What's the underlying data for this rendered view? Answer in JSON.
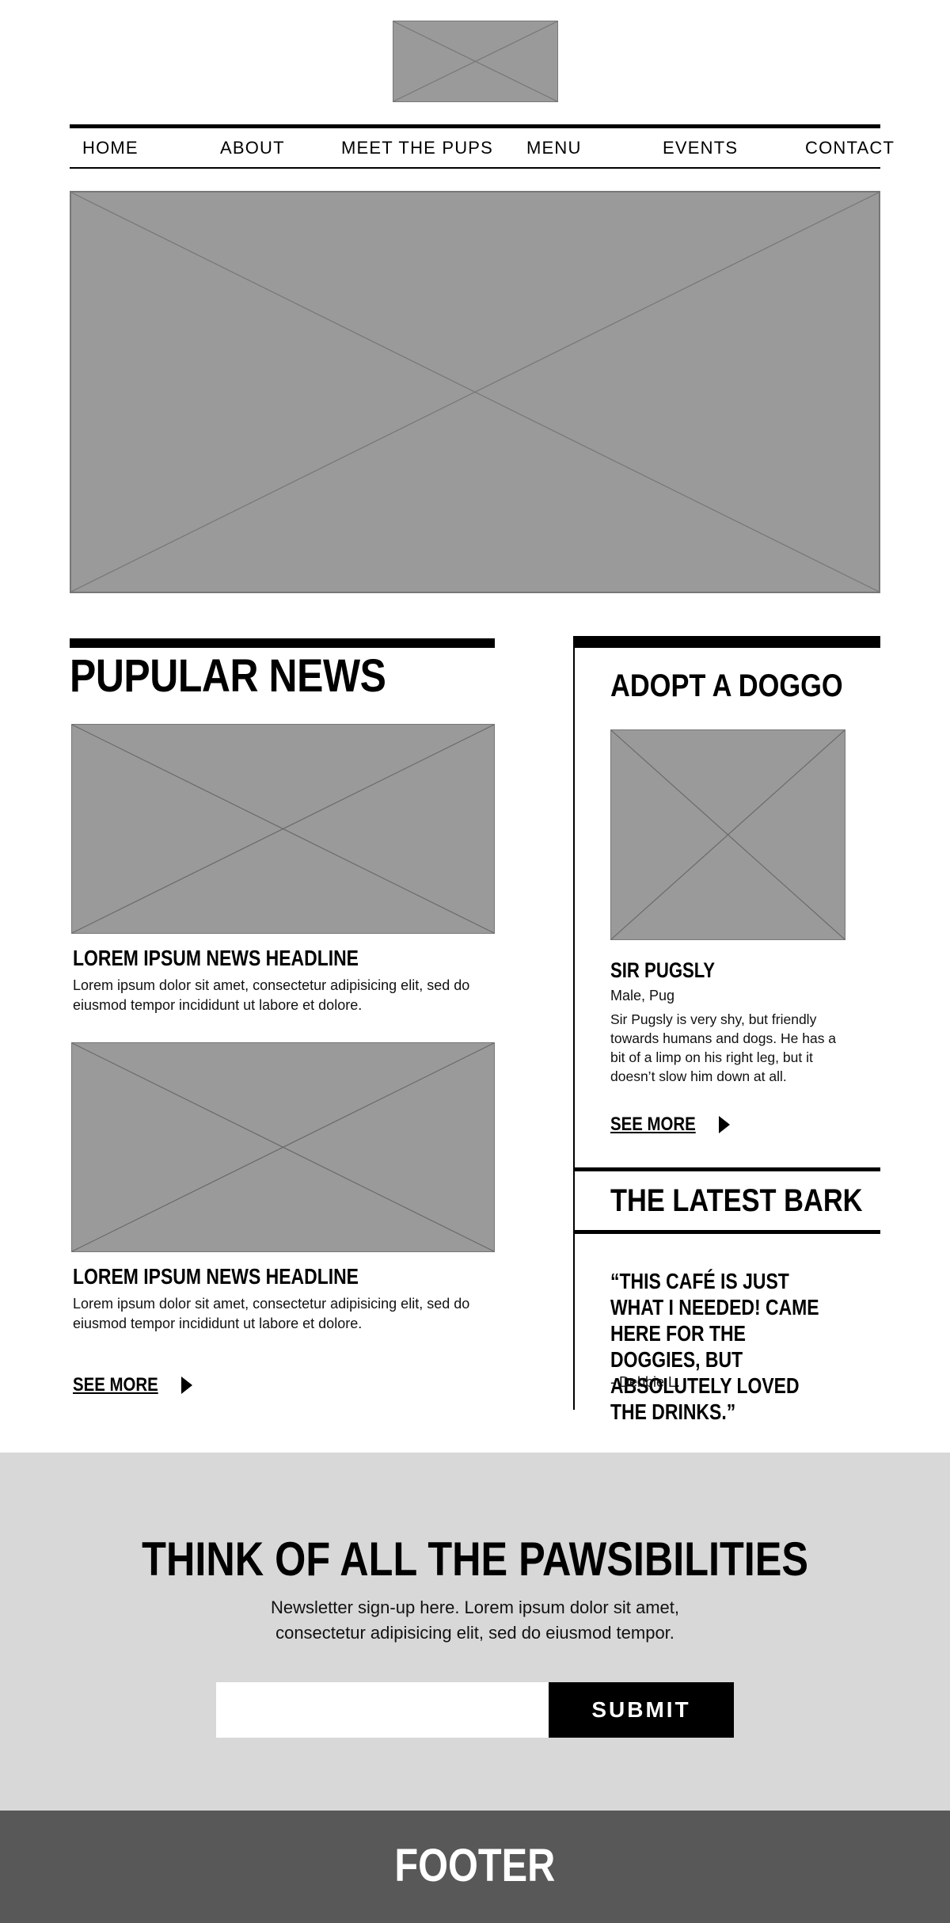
{
  "nav": {
    "items": [
      "HOME",
      "ABOUT",
      "MEET THE PUPS",
      "MENU",
      "EVENTS",
      "CONTACT"
    ]
  },
  "news": {
    "title": "PUPULAR NEWS",
    "articles": [
      {
        "headline": "LOREM IPSUM NEWS HEADLINE",
        "body": "Lorem ipsum dolor sit amet, consectetur adipisicing elit, sed do eiusmod tempor incididunt ut labore et dolore."
      },
      {
        "headline": "LOREM IPSUM NEWS HEADLINE",
        "body": "Lorem ipsum dolor sit amet, consectetur adipisicing elit, sed do eiusmod tempor incididunt ut labore et dolore."
      }
    ],
    "see_more": "SEE MORE"
  },
  "adopt": {
    "title": "ADOPT A DOGGO",
    "dog_name": "SIR PUGSLY",
    "dog_meta": "Male, Pug",
    "dog_description": "Sir Pugsly is very shy, but friendly towards humans and dogs. He has a bit of a limp on his right leg, but it doesn’t slow him down at all.",
    "see_more": "SEE MORE"
  },
  "latest_bark": {
    "title": "THE LATEST BARK",
    "quote": "“THIS CAFÉ IS JUST WHAT I NEEDED! CAME HERE FOR THE DOGGIES, BUT ABSOLUTELY LOVED THE DRINKS.”",
    "author": "- Debbie L."
  },
  "newsletter": {
    "title": "THINK OF ALL THE PAWSIBILITIES",
    "text": "Newsletter sign-up here. Lorem ipsum dolor sit amet, consectetur adipisicing elit, sed do eiusmod tempor.",
    "input_value": "",
    "submit_label": "SUBMIT"
  },
  "footer": {
    "label": "FOOTER"
  },
  "colors": {
    "placeholder": "#9a9a9a",
    "newsletter_bg": "#d8d8d8",
    "footer_bg": "#585858"
  }
}
